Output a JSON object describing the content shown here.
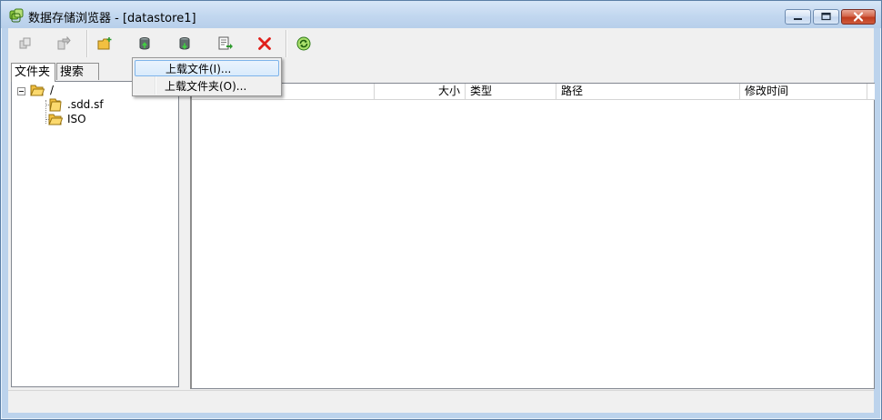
{
  "window": {
    "title": "数据存储浏览器 - [datastore1]"
  },
  "toolbar": {
    "buttons": [
      {
        "name": "copy-icon",
        "enabled": false
      },
      {
        "name": "move-icon",
        "enabled": false
      },
      {
        "name": "new-folder-icon",
        "enabled": true
      },
      {
        "name": "upload-icon",
        "enabled": true
      },
      {
        "name": "download-icon",
        "enabled": true
      },
      {
        "name": "register-vm-icon",
        "enabled": true
      },
      {
        "name": "delete-icon",
        "enabled": true
      },
      {
        "name": "refresh-icon",
        "enabled": true
      }
    ]
  },
  "tabs": [
    {
      "label": "文件夹",
      "active": true
    },
    {
      "label": "搜索",
      "active": false
    }
  ],
  "tree": {
    "root": "/",
    "children": [
      ".sdd.sf",
      "ISO"
    ]
  },
  "list": {
    "columns": [
      "大小",
      "类型",
      "路径",
      "修改时间"
    ]
  },
  "menu": {
    "items": [
      {
        "label": "上载文件(I)...",
        "highlighted": true
      },
      {
        "label": "上载文件夹(O)...",
        "highlighted": false
      }
    ]
  },
  "colors": {
    "delete": "#e0201b",
    "refresh": "#2e9a2e",
    "folder": "#f2c040"
  }
}
